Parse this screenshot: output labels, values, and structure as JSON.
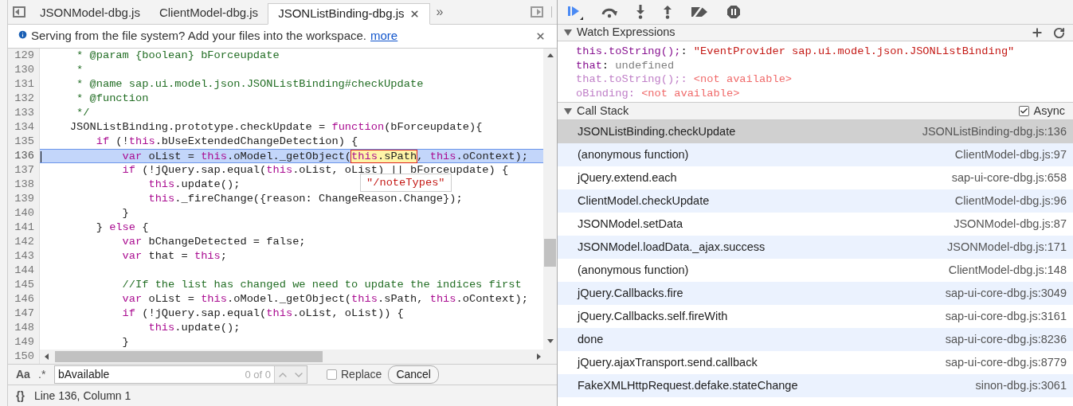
{
  "tabs": [
    {
      "label": "JSONModel-dbg.js",
      "selected": false
    },
    {
      "label": "ClientModel-dbg.js",
      "selected": false
    },
    {
      "label": "JSONListBinding-dbg.js",
      "selected": true
    }
  ],
  "more_tabs": "»",
  "info_bar": {
    "message": "Serving from the file system? Add your files into the workspace.",
    "link": "more"
  },
  "code": {
    "lines": [
      {
        "number": "129",
        "selected": false,
        "tokens": [
          {
            "kind": "comment",
            "text": "     * @param {boolean} bForceupdate"
          }
        ]
      },
      {
        "number": "130",
        "selected": false,
        "tokens": [
          {
            "kind": "comment",
            "text": "     *"
          }
        ]
      },
      {
        "number": "131",
        "selected": false,
        "tokens": [
          {
            "kind": "comment",
            "text": "     * @name sap.ui.model.json.JSONListBinding#checkUpdate"
          }
        ]
      },
      {
        "number": "132",
        "selected": false,
        "tokens": [
          {
            "kind": "comment",
            "text": "     * @function"
          }
        ]
      },
      {
        "number": "133",
        "selected": false,
        "tokens": [
          {
            "kind": "comment",
            "text": "     */"
          }
        ]
      },
      {
        "number": "134",
        "selected": false,
        "tokens": [
          {
            "kind": "plain",
            "text": "    JSONListBinding.prototype.checkUpdate = "
          },
          {
            "kind": "keyword",
            "text": "function"
          },
          {
            "kind": "plain",
            "text": "(bForceupdate){"
          }
        ]
      },
      {
        "number": "135",
        "selected": false,
        "tokens": [
          {
            "kind": "keyword",
            "text": "        if"
          },
          {
            "kind": "plain",
            "text": " (!"
          },
          {
            "kind": "keyword",
            "text": "this"
          },
          {
            "kind": "plain",
            "text": ".bUseExtendedChangeDetection) {"
          }
        ]
      },
      {
        "number": "136",
        "selected": true,
        "tokens": [
          {
            "kind": "keyword",
            "text": "            var"
          },
          {
            "kind": "plain",
            "text": " oList = "
          },
          {
            "kind": "keyword",
            "text": "this"
          },
          {
            "kind": "plain",
            "text": ".oModel._getObject("
          },
          {
            "kind": "match",
            "parts": [
              {
                "kind": "keyword",
                "text": "this"
              },
              {
                "kind": "plain",
                "text": ".sPath"
              }
            ]
          },
          {
            "kind": "plain",
            "text": ", "
          },
          {
            "kind": "keyword",
            "text": "this"
          },
          {
            "kind": "plain",
            "text": ".oContext);"
          }
        ]
      },
      {
        "number": "137",
        "selected": false,
        "tokens": [
          {
            "kind": "keyword",
            "text": "            if"
          },
          {
            "kind": "plain",
            "text": " (!jQuery.sap.equal("
          },
          {
            "kind": "keyword",
            "text": "this"
          },
          {
            "kind": "plain",
            "text": ".oList, oList) || bForceupdate) {"
          }
        ]
      },
      {
        "number": "138",
        "selected": false,
        "tokens": [
          {
            "kind": "keyword",
            "text": "                this"
          },
          {
            "kind": "plain",
            "text": ".update();"
          }
        ]
      },
      {
        "number": "139",
        "selected": false,
        "tokens": [
          {
            "kind": "keyword",
            "text": "                this"
          },
          {
            "kind": "plain",
            "text": "._fireChange({reason: ChangeReason.Change});"
          }
        ]
      },
      {
        "number": "140",
        "selected": false,
        "tokens": [
          {
            "kind": "plain",
            "text": "            }"
          }
        ]
      },
      {
        "number": "141",
        "selected": false,
        "tokens": [
          {
            "kind": "plain",
            "text": "        } "
          },
          {
            "kind": "keyword",
            "text": "else"
          },
          {
            "kind": "plain",
            "text": " {"
          }
        ]
      },
      {
        "number": "142",
        "selected": false,
        "tokens": [
          {
            "kind": "keyword",
            "text": "            var"
          },
          {
            "kind": "plain",
            "text": " bChangeDetected = false;"
          }
        ]
      },
      {
        "number": "143",
        "selected": false,
        "tokens": [
          {
            "kind": "keyword",
            "text": "            var"
          },
          {
            "kind": "plain",
            "text": " that = "
          },
          {
            "kind": "keyword",
            "text": "this"
          },
          {
            "kind": "plain",
            "text": ";"
          }
        ]
      },
      {
        "number": "144",
        "selected": false
      },
      {
        "number": "145",
        "selected": false,
        "tokens": [
          {
            "kind": "comment",
            "text": "            //If the list has changed we need to update the indices first"
          }
        ]
      },
      {
        "number": "146",
        "selected": false,
        "tokens": [
          {
            "kind": "keyword",
            "text": "            var"
          },
          {
            "kind": "plain",
            "text": " oList = "
          },
          {
            "kind": "keyword",
            "text": "this"
          },
          {
            "kind": "plain",
            "text": ".oModel._getObject("
          },
          {
            "kind": "keyword",
            "text": "this"
          },
          {
            "kind": "plain",
            "text": ".sPath, "
          },
          {
            "kind": "keyword",
            "text": "this"
          },
          {
            "kind": "plain",
            "text": ".oContext);"
          }
        ]
      },
      {
        "number": "147",
        "selected": false,
        "tokens": [
          {
            "kind": "keyword",
            "text": "            if"
          },
          {
            "kind": "plain",
            "text": " (!jQuery.sap.equal("
          },
          {
            "kind": "keyword",
            "text": "this"
          },
          {
            "kind": "plain",
            "text": ".oList, oList)) {"
          }
        ]
      },
      {
        "number": "148",
        "selected": false,
        "tokens": [
          {
            "kind": "keyword",
            "text": "                this"
          },
          {
            "kind": "plain",
            "text": ".update();"
          }
        ]
      },
      {
        "number": "149",
        "selected": false,
        "tokens": [
          {
            "kind": "plain",
            "text": "            }"
          }
        ]
      },
      {
        "number": "150",
        "selected": false
      }
    ],
    "tooltip": "\"/noteTypes\""
  },
  "search": {
    "case_label": "Aa",
    "regex_label": ".*",
    "value": "bAvailable",
    "count": "0 of 0",
    "replace": {
      "label": "Replace",
      "checked": false
    },
    "cancel": "Cancel"
  },
  "status_bar": {
    "pretty_print": "{}",
    "position": "Line 136, Column 1"
  },
  "watch": {
    "title": "Watch Expressions",
    "items": [
      {
        "name": "this.toString();",
        "separator": ":",
        "value": "\"EventProvider sap.ui.model.json.JSONListBinding\"",
        "kind": "string",
        "available": true
      },
      {
        "name": "that",
        "separator": ":",
        "value": "undefined",
        "kind": "undefined",
        "available": true
      },
      {
        "name": "that.toString();",
        "separator": ":",
        "value": "<not available>",
        "kind": "string",
        "available": false
      },
      {
        "name": "oBinding",
        "separator": ":",
        "value": "<not available>",
        "kind": "string",
        "available": false
      }
    ]
  },
  "call_stack": {
    "title": "Call Stack",
    "async": {
      "label": "Async",
      "checked": true
    },
    "frames": [
      {
        "name": "JSONListBinding.checkUpdate",
        "location": "JSONListBinding-dbg.js:136",
        "selected": true
      },
      {
        "name": "(anonymous function)",
        "location": "ClientModel-dbg.js:97",
        "selected": false
      },
      {
        "name": "jQuery.extend.each",
        "location": "sap-ui-core-dbg.js:658",
        "selected": false
      },
      {
        "name": "ClientModel.checkUpdate",
        "location": "ClientModel-dbg.js:96",
        "selected": false
      },
      {
        "name": "JSONModel.setData",
        "location": "JSONModel-dbg.js:87",
        "selected": false
      },
      {
        "name": "JSONModel.loadData._ajax.success",
        "location": "JSONModel-dbg.js:171",
        "selected": false
      },
      {
        "name": "(anonymous function)",
        "location": "ClientModel-dbg.js:148",
        "selected": false
      },
      {
        "name": "jQuery.Callbacks.fire",
        "location": "sap-ui-core-dbg.js:3049",
        "selected": false
      },
      {
        "name": "jQuery.Callbacks.self.fireWith",
        "location": "sap-ui-core-dbg.js:3161",
        "selected": false
      },
      {
        "name": "done",
        "location": "sap-ui-core-dbg.js:8236",
        "selected": false
      },
      {
        "name": "jQuery.ajaxTransport.send.callback",
        "location": "sap-ui-core-dbg.js:8779",
        "selected": false
      },
      {
        "name": "FakeXMLHttpRequest.defake.stateChange",
        "location": "sinon-dbg.js:3061",
        "selected": false
      }
    ]
  }
}
